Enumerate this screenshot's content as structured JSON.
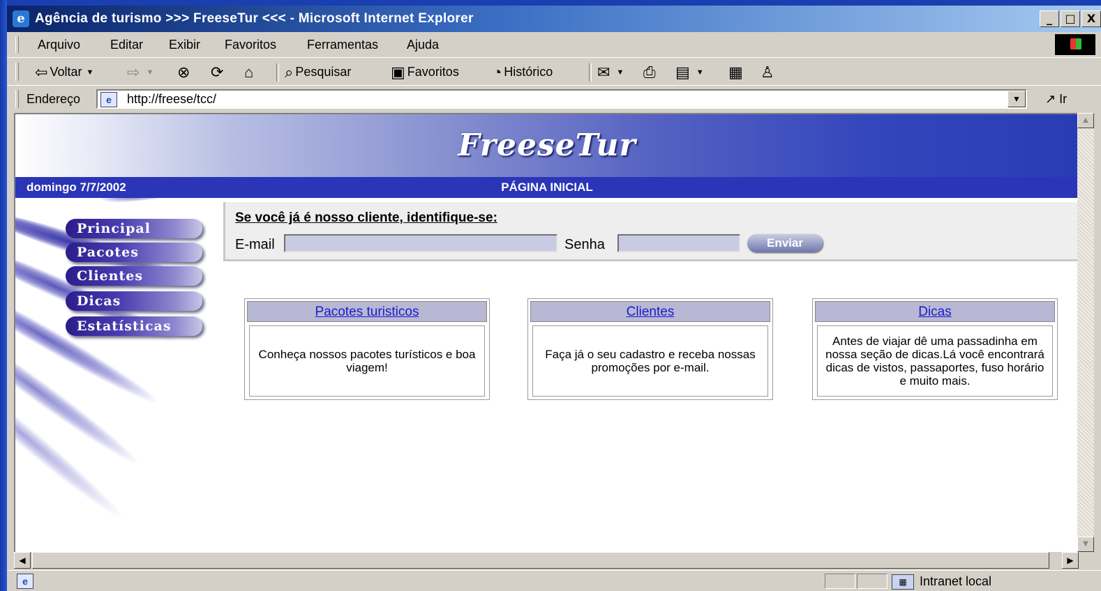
{
  "window": {
    "title": "Agência de turismo >>> FreeseTur <<< - Microsoft Internet Explorer",
    "controls": [
      "_",
      "□",
      "X"
    ]
  },
  "menubar": {
    "items": [
      "Arquivo",
      "Editar",
      "Exibir",
      "Favoritos",
      "Ferramentas",
      "Ajuda"
    ]
  },
  "toolbar": {
    "back": "Voltar",
    "search": "Pesquisar",
    "favorites": "Favoritos",
    "history": "Histórico"
  },
  "address": {
    "label": "Endereço",
    "url": "http://freese/tcc/",
    "go": "Ir"
  },
  "page": {
    "logo": "FreeseTur",
    "date": "domingo 7/7/2002",
    "title": "PÁGINA INICIAL",
    "menu": [
      "Principal",
      "Pacotes",
      "Clientes",
      "Dicas",
      "Estatísticas"
    ],
    "login": {
      "title": "Se você já é nosso cliente, identifique-se:",
      "email_label": "E-mail",
      "email_value": "",
      "password_label": "Senha",
      "password_value": "",
      "submit": "Enviar"
    },
    "cards": [
      {
        "title": "Pacotes turisticos",
        "text": "Conheça nossos pacotes turísticos e boa viagem!"
      },
      {
        "title": "Clientes",
        "text": "Faça já o seu cadastro e receba nossas promoções por e-mail."
      },
      {
        "title": "Dicas",
        "text": "Antes de viajar dê uma passadinha em nossa seção de dicas.Lá você encontrará dicas de vistos, passaportes, fuso horário e muito mais."
      }
    ]
  },
  "status": {
    "zone": "Intranet local"
  },
  "colors": {
    "navbar": "#2a35b8",
    "titlebar": "#0a246a",
    "link": "#1a1acc"
  }
}
